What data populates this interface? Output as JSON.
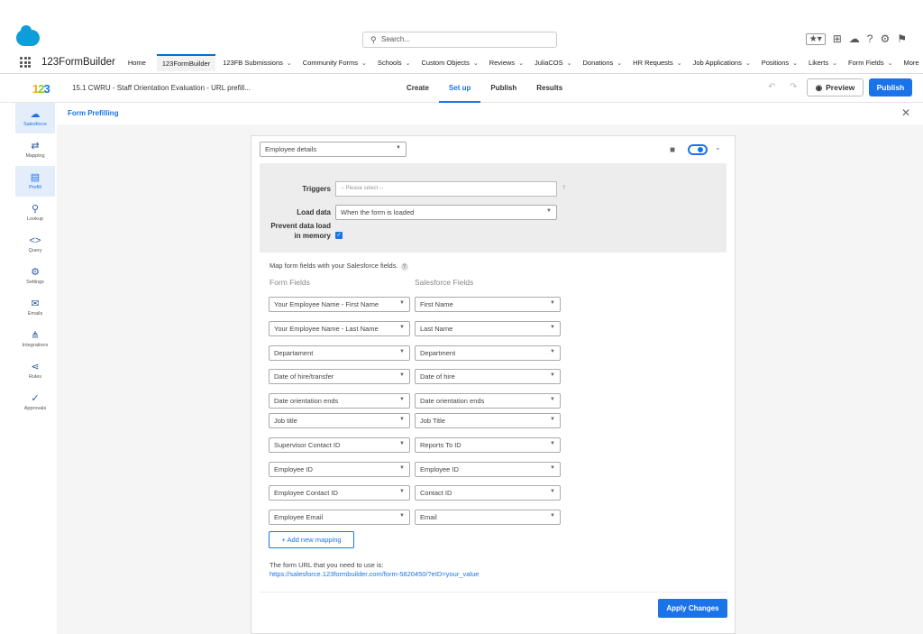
{
  "header": {
    "search_placeholder": "Search...",
    "app_name": "123FormBuilder",
    "nav_items": [
      {
        "label": "Home"
      },
      {
        "label": "123FormBuilder"
      },
      {
        "label": "123FB Submissions"
      },
      {
        "label": "Community Forms"
      },
      {
        "label": "Schools"
      },
      {
        "label": "Custom Objects"
      },
      {
        "label": "Reviews"
      },
      {
        "label": "JuliaCOS"
      },
      {
        "label": "Donations"
      },
      {
        "label": "HR Requests"
      },
      {
        "label": "Job Applications"
      },
      {
        "label": "Positions"
      },
      {
        "label": "Likerts"
      },
      {
        "label": "Form Fields"
      },
      {
        "label": "More"
      }
    ]
  },
  "toolbar": {
    "logo_digits": [
      "1",
      "2",
      "3"
    ],
    "form_title": "15.1 CWRU - Staff Orientation Evaluation - URL prefill...",
    "tabs": [
      {
        "label": "Create"
      },
      {
        "label": "Set up"
      },
      {
        "label": "Publish"
      },
      {
        "label": "Results"
      }
    ],
    "preview_label": "Preview",
    "publish_label": "Publish"
  },
  "sidebar": {
    "items": [
      {
        "label": "Salesforce",
        "icon": "cloud-icon"
      },
      {
        "label": "Mapping",
        "icon": "mapping-icon"
      },
      {
        "label": "Prefill",
        "icon": "document-icon"
      },
      {
        "label": "Lookup",
        "icon": "search-icon"
      },
      {
        "label": "Query",
        "icon": "code-icon"
      },
      {
        "label": "Settings",
        "icon": "gear-icon"
      },
      {
        "label": "Emails",
        "icon": "mail-icon"
      },
      {
        "label": "Integrations",
        "icon": "integrations-icon"
      },
      {
        "label": "Rules",
        "icon": "rules-icon"
      },
      {
        "label": "Approvals",
        "icon": "approvals-icon"
      }
    ]
  },
  "panel": {
    "title": "Form Prefilling",
    "object_select": "Employee details",
    "triggers_label": "Triggers",
    "triggers_placeholder": "-- Please select --",
    "load_data_label": "Load data",
    "load_data_value": "When the form is loaded",
    "prevent_label_1": "Prevent data load",
    "prevent_label_2": "in memory",
    "map_caption": "Map form fields with your Salesforce fields.",
    "form_fields_header": "Form Fields",
    "salesforce_fields_header": "Salesforce Fields",
    "mappings": [
      {
        "form": "Your Employee Name - First Name",
        "sf": "First Name"
      },
      {
        "form": "Your Employee Name - Last Name",
        "sf": "Last Name"
      },
      {
        "form": "Departament",
        "sf": "Department"
      },
      {
        "form": "Date of hire/transfer",
        "sf": "Date of hire"
      },
      {
        "form": "Date orientation ends",
        "sf": "Date orientation ends"
      },
      {
        "form": "Job title",
        "sf": "Job Title"
      },
      {
        "form": "Supervisor Contact ID",
        "sf": "Reports To ID"
      },
      {
        "form": "Employee ID",
        "sf": "Employee ID"
      },
      {
        "form": "Employee Contact ID",
        "sf": "Contact ID"
      },
      {
        "form": "Employee Email",
        "sf": "Email"
      }
    ],
    "add_mapping_label": "+ Add new mapping",
    "url_label": "The form URL that you need to use is:",
    "url_value": "https://salesforce.123formbuilder.com/form-5820450/?eID=your_value",
    "apply_label": "Apply Changes"
  },
  "colors": {
    "accent": "#1a73e8",
    "sidebar_active_bg": "#e4eefb",
    "page_bg": "#f5f5f5"
  }
}
